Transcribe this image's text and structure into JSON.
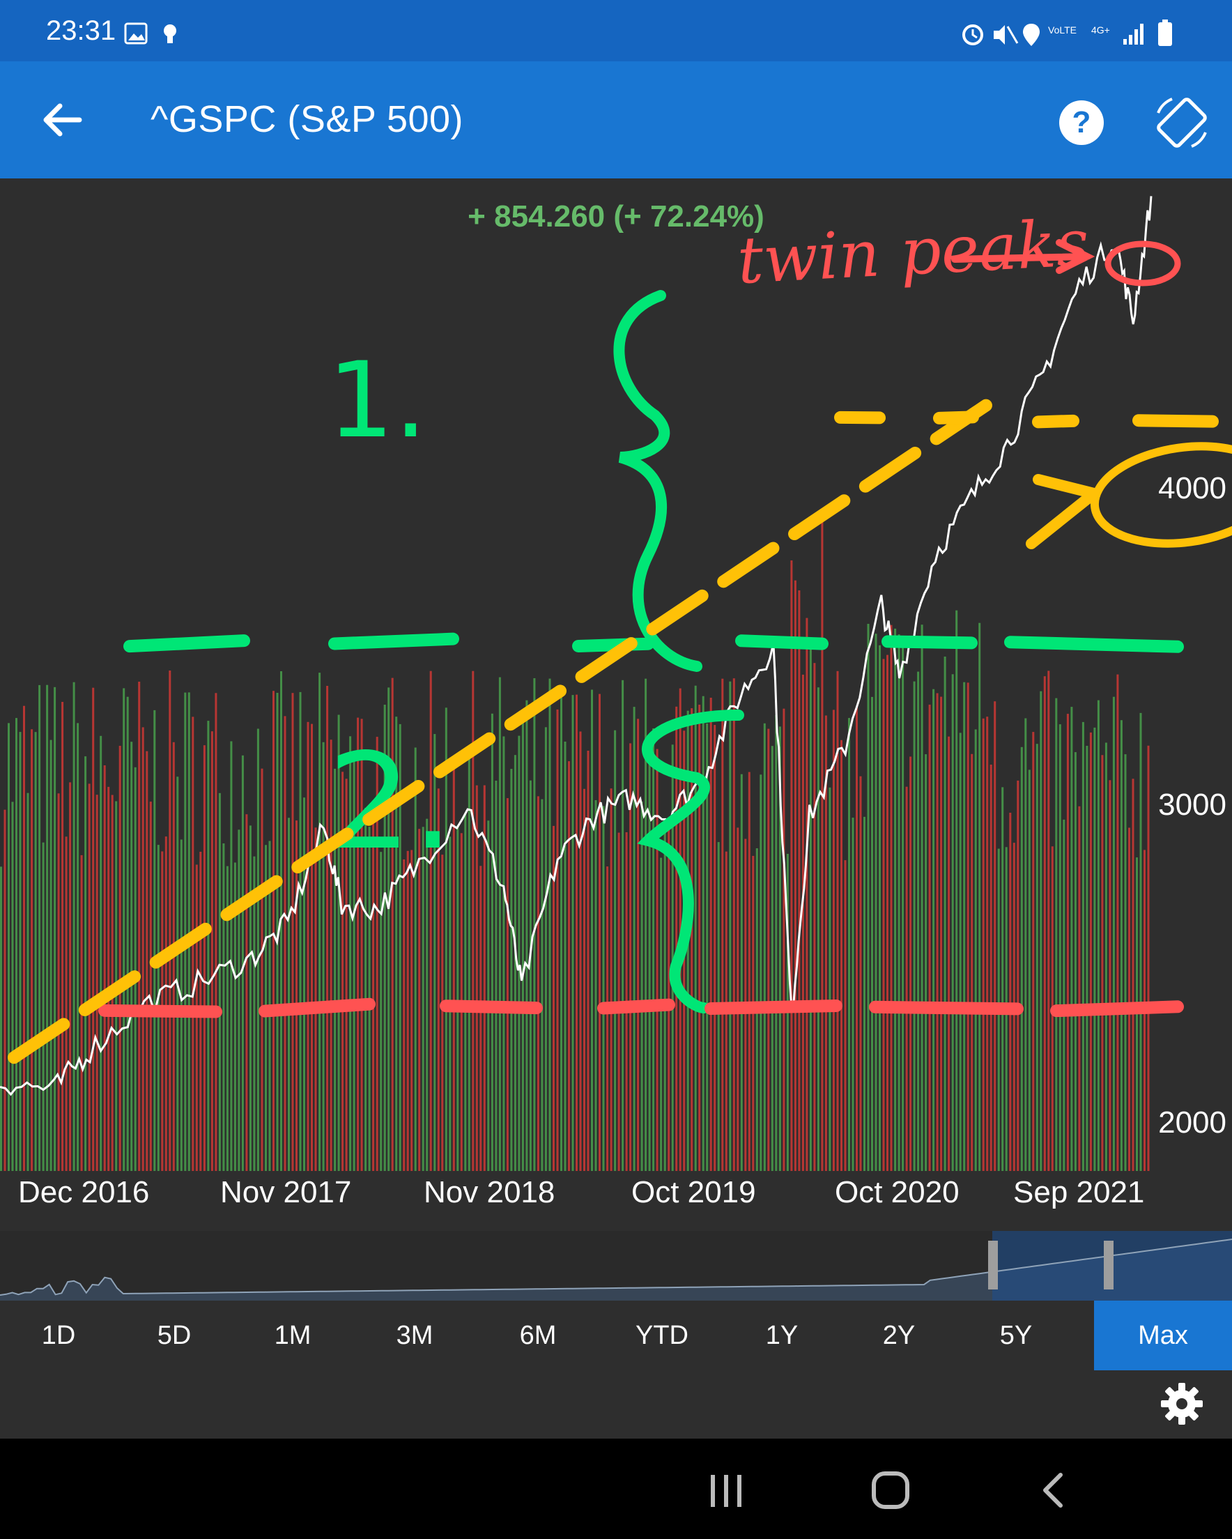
{
  "status_bar": {
    "time": "23:31"
  },
  "app_bar": {
    "title": "^GSPC (S&P 500)"
  },
  "chart": {
    "change_label": "+ 854.260 (+ 72.24%)",
    "y_ticks": [
      "4000",
      "3000",
      "2000"
    ],
    "x_ticks": [
      "Dec 2016",
      "Nov 2017",
      "Nov 2018",
      "Oct 2019",
      "Oct 2020",
      "Sep 2021"
    ]
  },
  "annotations": {
    "twin_peaks_text": "twin peaks",
    "marker_1": "1.",
    "marker_2": "2."
  },
  "range_buttons": [
    "1D",
    "5D",
    "1M",
    "3M",
    "6M",
    "YTD",
    "1Y",
    "2Y",
    "5Y",
    "Max"
  ],
  "active_range": "Max",
  "colors": {
    "status_bar": "#1565c0",
    "app_bar": "#1976d2",
    "price_line": "#ffffff",
    "volume_up": "#4caf50",
    "volume_down": "#e53935",
    "annotation_green": "#00e676",
    "annotation_yellow": "#ffc107",
    "annotation_red": "#ff5252"
  },
  "chart_data": {
    "type": "line",
    "title": "",
    "x_ticks": [
      "Dec 2016",
      "Nov 2017",
      "Nov 2018",
      "Oct 2019",
      "Oct 2020",
      "Sep 2021"
    ],
    "ylim": [
      1900,
      4700
    ],
    "y_ticks": [
      2000,
      3000,
      4000
    ],
    "x": [
      "2016-07",
      "2016-10",
      "2016-12",
      "2017-03",
      "2017-06",
      "2017-09",
      "2017-11",
      "2018-01",
      "2018-02",
      "2018-04",
      "2018-06",
      "2018-09",
      "2018-11",
      "2018-12",
      "2019-02",
      "2019-04",
      "2019-06",
      "2019-08",
      "2019-10",
      "2019-12",
      "2020-02",
      "2020-03",
      "2020-04",
      "2020-06",
      "2020-08",
      "2020-09",
      "2020-11",
      "2021-01",
      "2021-03",
      "2021-05",
      "2021-07",
      "2021-09",
      "2021-10",
      "2021-11"
    ],
    "series": [
      {
        "values": [
          2150,
          2130,
          2240,
          2370,
          2430,
          2500,
          2600,
          2870,
          2650,
          2640,
          2750,
          2930,
          2700,
          2420,
          2780,
          2900,
          2950,
          2900,
          3000,
          3230,
          3380,
          2330,
          2900,
          3100,
          3500,
          3300,
          3640,
          3800,
          3950,
          4150,
          4400,
          4530,
          4300,
          4650
        ]
      }
    ],
    "volume": {
      "x_range": [
        "2016-07",
        "2021-11"
      ],
      "relative_level": 0.45
    },
    "annotations": {
      "green_lines_y": 3390,
      "red_lines_y": 2360,
      "yellow_trend_start": [
        "2016-07",
        2220
      ],
      "yellow_trend_end": [
        "2021-03",
        4100
      ]
    }
  }
}
